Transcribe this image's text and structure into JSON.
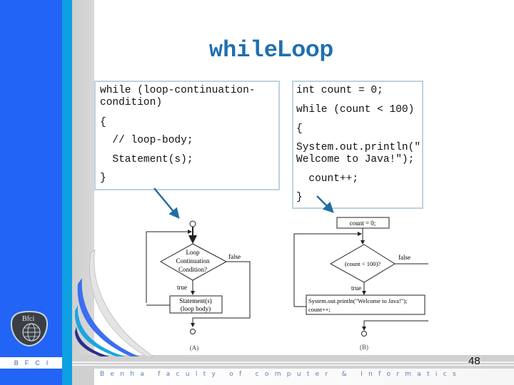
{
  "slide": {
    "title_code": "while",
    "title_rest": "Loop",
    "page_number": "48",
    "branding": {
      "short": "BFCI",
      "footer": "Benha faculty of computer & Informatics",
      "logo_text": "Bfci"
    },
    "colors": {
      "title": "#1f6fb0",
      "strip_blue": "#2264f5",
      "strip_cyan": "#0ea0e0",
      "box_border": "#bcd3de",
      "arrow": "#1f6fa0"
    }
  },
  "syntax_box": {
    "lines": [
      "while (loop-continuation-",
      "condition)",
      "{",
      "  // loop-body;",
      "  Statement(s);",
      "}"
    ]
  },
  "example_box": {
    "lines": [
      "int count = 0;",
      "while (count < 100)",
      "{",
      "System.out.println(\"",
      "Welcome to Java!\");",
      "  count++;",
      "}"
    ]
  },
  "flowchart_a": {
    "decision_lines": [
      "Loop",
      "Continuation",
      "Condition?"
    ],
    "true_label": "true",
    "false_label": "false",
    "body_lines": [
      "Statement(s)",
      "(loop body)"
    ],
    "caption": "(A)"
  },
  "flowchart_b": {
    "init": "count = 0;",
    "decision": "(count < 100)?",
    "true_label": "true",
    "false_label": "false",
    "body_lines": [
      "System.out.println(\"Welcome to Java!\");",
      "count++;"
    ],
    "caption": "(B)"
  }
}
